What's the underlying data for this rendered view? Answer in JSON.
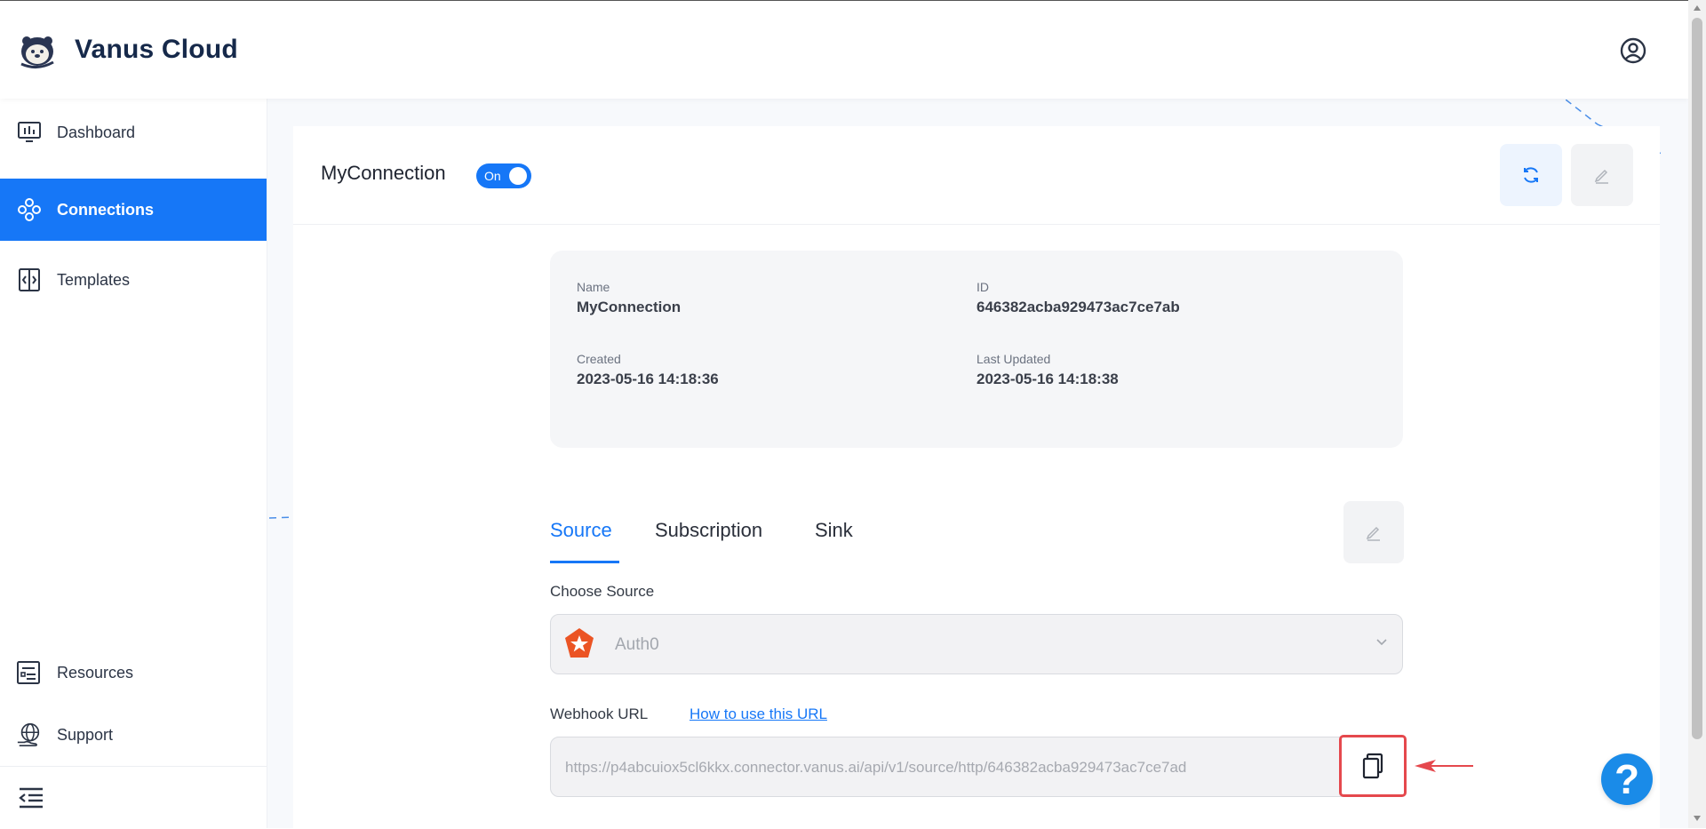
{
  "app": {
    "brand": "Vanus Cloud"
  },
  "sidebar": {
    "items": [
      {
        "label": "Dashboard",
        "icon": "monitor-chart-icon",
        "active": false
      },
      {
        "label": "Connections",
        "icon": "connections-icon",
        "active": true
      },
      {
        "label": "Templates",
        "icon": "templates-icon",
        "active": false
      }
    ],
    "bottom_items": [
      {
        "label": "Resources",
        "icon": "resources-list-icon"
      },
      {
        "label": "Support",
        "icon": "globe-hand-icon"
      }
    ]
  },
  "connection": {
    "title": "MyConnection",
    "toggle_label": "On",
    "toggle_on": true,
    "info": {
      "name_label": "Name",
      "name_value": "MyConnection",
      "id_label": "ID",
      "id_value": "646382acba929473ac7ce7ab",
      "created_label": "Created",
      "created_value": "2023-05-16 14:18:36",
      "updated_label": "Last Updated",
      "updated_value": "2023-05-16 14:18:38"
    }
  },
  "tabs": {
    "items": [
      {
        "label": "Source",
        "active": true
      },
      {
        "label": "Subscription",
        "active": false
      },
      {
        "label": "Sink",
        "active": false
      }
    ]
  },
  "source": {
    "choose_label": "Choose Source",
    "selected": "Auth0",
    "webhook_label": "Webhook URL",
    "howto_link": "How to use this URL",
    "webhook_url": "https://p4abcuiox5cl6kkx.connector.vanus.ai/api/v1/source/http/646382acba929473ac7ce7ad"
  },
  "help": {
    "label": "?"
  },
  "colors": {
    "primary": "#1677f7",
    "brand_text": "#16294a",
    "highlight_red": "#e5484d",
    "auth0_orange": "#eb5424",
    "help_blue": "#1a8be8"
  }
}
